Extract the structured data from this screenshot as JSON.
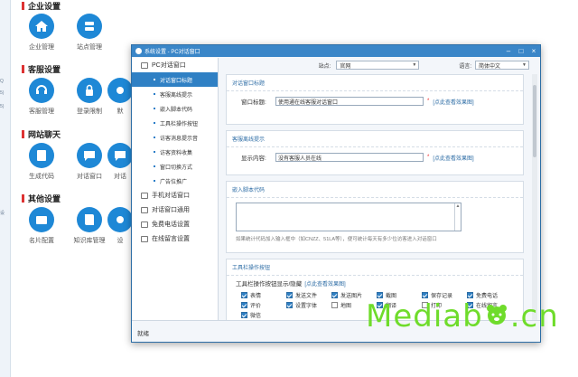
{
  "background": {
    "left_ticks": [
      "Q",
      "5)",
      "5)",
      "设"
    ],
    "sections": [
      {
        "title": "企业设置",
        "tiles": [
          {
            "label": "企业管理",
            "icon": "home-icon"
          },
          {
            "label": "站点管理",
            "icon": "server-icon"
          }
        ]
      },
      {
        "title": "客服设置",
        "tiles": [
          {
            "label": "客服管理",
            "icon": "headset-icon"
          },
          {
            "label": "登录限制",
            "icon": "lock-icon"
          },
          {
            "label": "默",
            "icon": "generic-icon"
          }
        ]
      },
      {
        "title": "网站聊天",
        "tiles": [
          {
            "label": "生成代码",
            "icon": "code-icon"
          },
          {
            "label": "对话窗口",
            "icon": "chat-icon"
          },
          {
            "label": "对话",
            "icon": "chat-icon"
          }
        ]
      },
      {
        "title": "其他设置",
        "tiles": [
          {
            "label": "名片配置",
            "icon": "card-icon"
          },
          {
            "label": "知识库管理",
            "icon": "book-icon"
          },
          {
            "label": "设",
            "icon": "generic-icon"
          }
        ]
      }
    ]
  },
  "dialog": {
    "title": "系统设置 - PC对话窗口",
    "site_label": "站点:",
    "site_value": "官网",
    "lang_label": "语言:",
    "lang_value": "简体中文",
    "status": "就绪",
    "nav": [
      {
        "label": "PC对话窗口",
        "type": "group"
      },
      {
        "label": "对话窗口标题",
        "type": "sub",
        "active": true
      },
      {
        "label": "客服离线提示",
        "type": "sub"
      },
      {
        "label": "嵌入脚本代码",
        "type": "sub"
      },
      {
        "label": "工具栏操作按钮",
        "type": "sub"
      },
      {
        "label": "访客消息提示音",
        "type": "sub"
      },
      {
        "label": "访客资料收集",
        "type": "sub"
      },
      {
        "label": "窗口切换方式",
        "type": "sub"
      },
      {
        "label": "广告位推广",
        "type": "sub"
      },
      {
        "label": "手机对话窗口",
        "type": "group"
      },
      {
        "label": "对话窗口通用",
        "type": "group"
      },
      {
        "label": "免费电话设置",
        "type": "group"
      },
      {
        "label": "在线留言设置",
        "type": "group"
      }
    ],
    "sections": {
      "title_panel": {
        "heading": "对话窗口标题",
        "label": "窗口标题:",
        "value": "使用通在线客服对话窗口",
        "hint": "[点此查看效果图]"
      },
      "offline_panel": {
        "heading": "客服离线提示",
        "label": "显示内容:",
        "value": "没有客服人员在线",
        "hint": "[点此查看效果图]"
      },
      "script_panel": {
        "heading": "嵌入脚本代码",
        "note": "如果统计代码加入输入框中（如CNZZ、51LA等），便可统计每天有多少位访客进入对话窗口"
      },
      "toolbar_panel": {
        "heading": "工具栏操作按钮",
        "label": "工具栏操作按钮显示/隐藏",
        "hint": "[点此查看效果图]",
        "options": [
          {
            "label": "表情",
            "checked": true
          },
          {
            "label": "发送文件",
            "checked": true
          },
          {
            "label": "发送图片",
            "checked": true
          },
          {
            "label": "截图",
            "checked": true
          },
          {
            "label": "保存记录",
            "checked": true
          },
          {
            "label": "免费电话",
            "checked": true
          },
          {
            "label": "评价",
            "checked": true
          },
          {
            "label": "设置字体",
            "checked": true
          },
          {
            "label": "地图",
            "checked": false
          },
          {
            "label": "翻译",
            "checked": true
          },
          {
            "label": "打印",
            "checked": false
          },
          {
            "label": "在线留言",
            "checked": true
          },
          {
            "label": "微信",
            "checked": true
          }
        ]
      }
    }
  },
  "watermark": {
    "left": "Mediab",
    "right": ".cn"
  },
  "colors": {
    "accent": "#2f80c4",
    "titlebar": "#3a86c8",
    "tile": "#1e88d6",
    "watermark": "#6fdc2b"
  }
}
